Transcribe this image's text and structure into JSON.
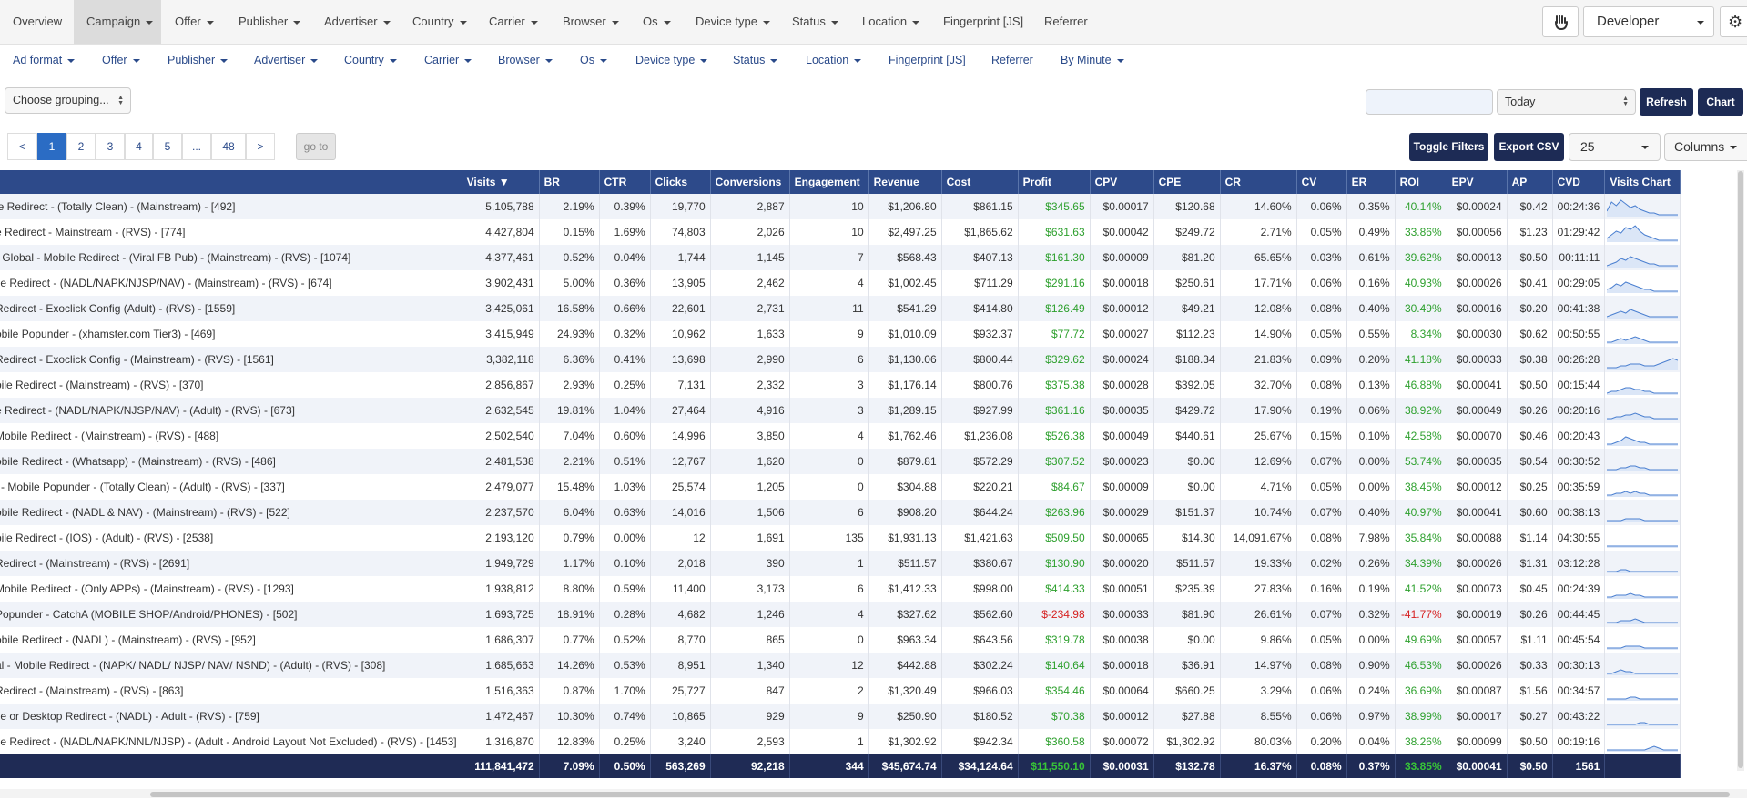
{
  "topnav": {
    "items": [
      {
        "label": "Overview",
        "caret": false,
        "active": false
      },
      {
        "label": "Campaign",
        "caret": true,
        "active": true
      },
      {
        "label": "Offer",
        "caret": true,
        "active": false
      },
      {
        "label": "Publisher",
        "caret": true,
        "active": false
      },
      {
        "label": "Advertiser",
        "caret": true,
        "active": false
      },
      {
        "label": "Country",
        "caret": true,
        "active": false
      },
      {
        "label": "Carrier",
        "caret": true,
        "active": false
      },
      {
        "label": "Browser",
        "caret": true,
        "active": false
      },
      {
        "label": "Os",
        "caret": true,
        "active": false
      },
      {
        "label": "Device type",
        "caret": true,
        "active": false
      },
      {
        "label": "Status",
        "caret": true,
        "active": false
      },
      {
        "label": "Location",
        "caret": true,
        "active": false
      },
      {
        "label": "Fingerprint [JS]",
        "caret": false,
        "active": false
      },
      {
        "label": "Referrer",
        "caret": false,
        "active": false
      }
    ],
    "user": "Developer"
  },
  "subnav": {
    "items": [
      {
        "label": "Ad format"
      },
      {
        "label": "Offer"
      },
      {
        "label": "Publisher"
      },
      {
        "label": "Advertiser"
      },
      {
        "label": "Country"
      },
      {
        "label": "Carrier"
      },
      {
        "label": "Browser"
      },
      {
        "label": "Os"
      },
      {
        "label": "Device type"
      },
      {
        "label": "Status"
      },
      {
        "label": "Location"
      },
      {
        "label": "Fingerprint [JS]",
        "caret": false
      },
      {
        "label": "Referrer",
        "caret": false
      },
      {
        "label": "By Minute"
      }
    ]
  },
  "controls": {
    "grouping": "Choose grouping...",
    "date_range": "Today",
    "date_input": "",
    "refresh": "Refresh",
    "chart": "Chart",
    "toggle_filters": "Toggle Filters",
    "export_csv": "Export CSV",
    "per_page": "25",
    "columns": "Columns"
  },
  "pagination": {
    "prev": "<",
    "pages": [
      "1",
      "2",
      "3",
      "4",
      "5",
      "...",
      "48"
    ],
    "next": ">",
    "current": "1",
    "goto": "go to"
  },
  "table": {
    "columns": [
      "",
      "Visits ▼",
      "BR",
      "CTR",
      "Clicks",
      "Conversions",
      "Engagement",
      "Revenue",
      "Cost",
      "Profit",
      "CPV",
      "CPE",
      "CR",
      "CV",
      "ER",
      "ROI",
      "EPV",
      "AP",
      "CVD",
      "Visits Chart"
    ],
    "rows": [
      [
        "le Redirect - (Totally Clean) - (Mainstream) - [492]",
        "5,105,788",
        "2.19%",
        "0.39%",
        "19,770",
        "2,887",
        "10",
        "$1,206.80",
        "$861.15",
        "$345.65",
        "$0.00017",
        "$120.68",
        "14.60%",
        "0.06%",
        "0.35%",
        "40.14%",
        "$0.00024",
        "$0.42",
        "00:24:36"
      ],
      [
        "e Redirect - Mainstream - (RVS) - [774]",
        "4,427,804",
        "0.15%",
        "1.69%",
        "74,803",
        "2,026",
        "10",
        "$2,497.25",
        "$1,865.62",
        "$631.63",
        "$0.00042",
        "$249.72",
        "2.71%",
        "0.05%",
        "0.49%",
        "33.86%",
        "$0.00056",
        "$1.23",
        "01:29:42"
      ],
      [
        "- Global - Mobile Redirect - (Viral FB Pub) - (Mainstream) - (RVS) - [1074]",
        "4,377,461",
        "0.52%",
        "0.04%",
        "1,744",
        "1,145",
        "7",
        "$568.43",
        "$407.13",
        "$161.30",
        "$0.00009",
        "$81.20",
        "65.65%",
        "0.03%",
        "0.61%",
        "39.62%",
        "$0.00013",
        "$0.50",
        "00:11:11"
      ],
      [
        "ile Redirect - (NADL/NAPK/NJSP/NAV) - (Mainstream) - (RVS) - [674]",
        "3,902,431",
        "5.00%",
        "0.36%",
        "13,905",
        "2,462",
        "4",
        "$1,002.45",
        "$711.29",
        "$291.16",
        "$0.00018",
        "$250.61",
        "17.71%",
        "0.06%",
        "0.16%",
        "40.93%",
        "$0.00026",
        "$0.41",
        "00:29:05"
      ],
      [
        "Redirect - Exoclick Config (Adult) - (RVS) - [1559]",
        "3,425,061",
        "16.58%",
        "0.66%",
        "22,601",
        "2,731",
        "11",
        "$541.29",
        "$414.80",
        "$126.49",
        "$0.00012",
        "$49.21",
        "12.08%",
        "0.08%",
        "0.40%",
        "30.49%",
        "$0.00016",
        "$0.20",
        "00:41:38"
      ],
      [
        "obile Popunder - (xhamster.com Tier3) - [469]",
        "3,415,949",
        "24.93%",
        "0.32%",
        "10,962",
        "1,633",
        "9",
        "$1,010.09",
        "$932.37",
        "$77.72",
        "$0.00027",
        "$112.23",
        "14.90%",
        "0.05%",
        "0.55%",
        "8.34%",
        "$0.00030",
        "$0.62",
        "00:50:55"
      ],
      [
        "Redirect - Exoclick Config - (Mainstream) - (RVS) - [1561]",
        "3,382,118",
        "6.36%",
        "0.41%",
        "13,698",
        "2,990",
        "6",
        "$1,130.06",
        "$800.44",
        "$329.62",
        "$0.00024",
        "$188.34",
        "21.83%",
        "0.09%",
        "0.20%",
        "41.18%",
        "$0.00033",
        "$0.38",
        "00:26:28"
      ],
      [
        "bile Redirect - (Mainstream) - (RVS) - [370]",
        "2,856,867",
        "2.93%",
        "0.25%",
        "7,131",
        "2,332",
        "3",
        "$1,176.14",
        "$800.76",
        "$375.38",
        "$0.00028",
        "$392.05",
        "32.70%",
        "0.08%",
        "0.13%",
        "46.88%",
        "$0.00041",
        "$0.50",
        "00:15:44"
      ],
      [
        "e Redirect - (NADL/NAPK/NJSP/NAV) - (Adult) - (RVS) - [673]",
        "2,632,545",
        "19.81%",
        "1.04%",
        "27,464",
        "4,916",
        "3",
        "$1,289.15",
        "$927.99",
        "$361.16",
        "$0.00035",
        "$429.72",
        "17.90%",
        "0.19%",
        "0.06%",
        "38.92%",
        "$0.00049",
        "$0.26",
        "00:20:16"
      ],
      [
        "Mobile Redirect - (Mainstream) - (RVS) - [488]",
        "2,502,540",
        "7.04%",
        "0.60%",
        "14,996",
        "3,850",
        "4",
        "$1,762.46",
        "$1,236.08",
        "$526.38",
        "$0.00049",
        "$440.61",
        "25.67%",
        "0.15%",
        "0.10%",
        "42.58%",
        "$0.00070",
        "$0.46",
        "00:20:43"
      ],
      [
        "obile Redirect - (Whatsapp) - (Mainstream) - (RVS) - [486]",
        "2,481,538",
        "2.21%",
        "0.51%",
        "12,767",
        "1,620",
        "0",
        "$879.81",
        "$572.29",
        "$307.52",
        "$0.00023",
        "$0.00",
        "12.69%",
        "0.07%",
        "0.00%",
        "53.74%",
        "$0.00035",
        "$0.54",
        "00:30:52"
      ],
      [
        "l - Mobile Popunder - (Totally Clean) - (Adult) - (RVS) - [337]",
        "2,479,077",
        "15.48%",
        "1.03%",
        "25,574",
        "1,205",
        "0",
        "$304.88",
        "$220.21",
        "$84.67",
        "$0.00009",
        "$0.00",
        "4.71%",
        "0.05%",
        "0.00%",
        "38.45%",
        "$0.00012",
        "$0.25",
        "00:35:59"
      ],
      [
        "obile Redirect - (NADL & NAV) - (Mainstream) - (RVS) - [522]",
        "2,237,570",
        "6.04%",
        "0.63%",
        "14,016",
        "1,506",
        "6",
        "$908.20",
        "$644.24",
        "$263.96",
        "$0.00029",
        "$151.37",
        "10.74%",
        "0.07%",
        "0.40%",
        "40.97%",
        "$0.00041",
        "$0.60",
        "00:38:13"
      ],
      [
        "bile Redirect - (IOS) - (Adult) - (RVS) - [2538]",
        "2,193,120",
        "0.79%",
        "0.00%",
        "12",
        "1,691",
        "135",
        "$1,931.13",
        "$1,421.63",
        "$509.50",
        "$0.00065",
        "$14.30",
        "14,091.67%",
        "0.08%",
        "7.98%",
        "35.84%",
        "$0.00088",
        "$1.14",
        "04:30:55"
      ],
      [
        "Redirect - (Mainstream) - (RVS) - [2691]",
        "1,949,729",
        "1.17%",
        "0.10%",
        "2,018",
        "390",
        "1",
        "$511.57",
        "$380.67",
        "$130.90",
        "$0.00020",
        "$511.57",
        "19.33%",
        "0.02%",
        "0.26%",
        "34.39%",
        "$0.00026",
        "$1.31",
        "03:12:28"
      ],
      [
        "Mobile Redirect - (Only APPs) - (Mainstream) - (RVS) - [1293]",
        "1,938,812",
        "8.80%",
        "0.59%",
        "11,400",
        "3,173",
        "6",
        "$1,412.33",
        "$998.00",
        "$414.33",
        "$0.00051",
        "$235.39",
        "27.83%",
        "0.16%",
        "0.19%",
        "41.52%",
        "$0.00073",
        "$0.45",
        "00:24:39"
      ],
      [
        "Popunder - CatchA (MOBILE SHOP/Android/PHONES) - [502]",
        "1,693,725",
        "18.91%",
        "0.28%",
        "4,682",
        "1,246",
        "4",
        "$327.62",
        "$562.60",
        "$-234.98",
        "$0.00033",
        "$81.90",
        "26.61%",
        "0.07%",
        "0.32%",
        "-41.77%",
        "$0.00019",
        "$0.26",
        "00:44:45"
      ],
      [
        "obile Redirect - (NADL) - (Mainstream) - (RVS) - [952]",
        "1,686,307",
        "0.77%",
        "0.52%",
        "8,770",
        "865",
        "0",
        "$963.34",
        "$643.56",
        "$319.78",
        "$0.00038",
        "$0.00",
        "9.86%",
        "0.05%",
        "0.00%",
        "49.69%",
        "$0.00057",
        "$1.11",
        "00:45:54"
      ],
      [
        "al - Mobile Redirect - (NAPK/ NADL/ NJSP/ NAV/ NSND) - (Adult) - (RVS) - [308]",
        "1,685,663",
        "14.26%",
        "0.53%",
        "8,951",
        "1,340",
        "12",
        "$442.88",
        "$302.24",
        "$140.64",
        "$0.00018",
        "$36.91",
        "14.97%",
        "0.08%",
        "0.90%",
        "46.53%",
        "$0.00026",
        "$0.33",
        "00:30:13"
      ],
      [
        "Redirect - (Mainstream) - (RVS) - [863]",
        "1,516,363",
        "0.87%",
        "1.70%",
        "25,727",
        "847",
        "2",
        "$1,320.49",
        "$966.03",
        "$354.46",
        "$0.00064",
        "$660.25",
        "3.29%",
        "0.06%",
        "0.24%",
        "36.69%",
        "$0.00087",
        "$1.56",
        "00:34:57"
      ],
      [
        "ile or Desktop Redirect - (NADL) - Adult - (RVS) - [759]",
        "1,472,467",
        "10.30%",
        "0.74%",
        "10,865",
        "929",
        "9",
        "$250.90",
        "$180.52",
        "$70.38",
        "$0.00012",
        "$27.88",
        "8.55%",
        "0.06%",
        "0.97%",
        "38.99%",
        "$0.00017",
        "$0.27",
        "00:43:22"
      ],
      [
        "ile Redirect - (NADL/NAPK/NNL/NJSP) - (Adult - Android Layout Not Excluded) - (RVS) - [1453]",
        "1,316,870",
        "12.83%",
        "0.25%",
        "3,240",
        "2,593",
        "1",
        "$1,302.92",
        "$942.34",
        "$360.58",
        "$0.00072",
        "$1,302.92",
        "80.03%",
        "0.20%",
        "0.04%",
        "38.26%",
        "$0.00099",
        "$0.50",
        "00:19:16"
      ]
    ],
    "totals": [
      "",
      "111,841,472",
      "7.09%",
      "0.50%",
      "563,269",
      "92,218",
      "344",
      "$45,674.74",
      "$34,124.64",
      "$11,550.10",
      "$0.00031",
      "$132.78",
      "16.37%",
      "0.08%",
      "0.37%",
      "33.85%",
      "$0.00041",
      "$0.50",
      "1561",
      ""
    ],
    "sparkline_color": "#4a7fd0",
    "sparklines": [
      [
        3,
        8,
        6,
        9,
        7,
        5,
        6,
        4,
        3,
        2,
        2,
        1,
        1,
        1,
        1,
        1
      ],
      [
        2,
        4,
        6,
        5,
        8,
        7,
        9,
        6,
        4,
        3,
        2,
        1,
        1,
        1,
        1,
        1
      ],
      [
        1,
        2,
        3,
        5,
        4,
        6,
        5,
        4,
        3,
        2,
        2,
        1,
        1,
        1,
        1,
        1
      ],
      [
        2,
        3,
        5,
        4,
        6,
        5,
        4,
        3,
        2,
        2,
        1,
        1,
        1,
        1,
        1,
        1
      ],
      [
        1,
        2,
        3,
        4,
        3,
        5,
        4,
        3,
        2,
        1,
        1,
        1,
        1,
        1,
        1,
        1
      ],
      [
        1,
        1,
        2,
        3,
        2,
        3,
        4,
        3,
        2,
        1,
        1,
        1,
        1,
        1,
        1,
        1
      ],
      [
        1,
        1,
        1,
        2,
        2,
        3,
        3,
        3,
        2,
        2,
        2,
        3,
        4,
        5,
        6,
        5
      ],
      [
        1,
        2,
        2,
        3,
        4,
        4,
        3,
        3,
        2,
        2,
        1,
        1,
        1,
        1,
        1,
        1
      ],
      [
        1,
        1,
        2,
        2,
        3,
        3,
        4,
        3,
        2,
        2,
        1,
        1,
        1,
        1,
        1,
        1
      ],
      [
        1,
        1,
        2,
        3,
        5,
        4,
        3,
        2,
        2,
        1,
        1,
        1,
        1,
        1,
        1,
        1
      ],
      [
        1,
        1,
        1,
        2,
        2,
        3,
        3,
        2,
        2,
        1,
        1,
        1,
        1,
        1,
        1,
        1
      ],
      [
        1,
        1,
        2,
        2,
        3,
        2,
        3,
        2,
        2,
        1,
        1,
        1,
        1,
        1,
        1,
        1
      ],
      [
        1,
        1,
        1,
        1,
        2,
        2,
        2,
        2,
        1,
        1,
        1,
        1,
        1,
        1,
        1,
        1
      ],
      [
        1,
        1,
        1,
        1,
        1,
        1,
        1,
        1,
        1,
        1,
        1,
        1,
        1,
        1,
        1,
        1
      ],
      [
        1,
        1,
        1,
        2,
        2,
        1,
        1,
        1,
        1,
        1,
        1,
        1,
        1,
        1,
        1,
        1
      ],
      [
        1,
        1,
        2,
        2,
        2,
        3,
        2,
        2,
        1,
        1,
        1,
        1,
        1,
        1,
        1,
        1
      ],
      [
        1,
        1,
        1,
        2,
        2,
        2,
        3,
        2,
        1,
        1,
        1,
        1,
        1,
        1,
        1,
        1
      ],
      [
        1,
        1,
        1,
        1,
        2,
        2,
        2,
        2,
        1,
        1,
        1,
        1,
        1,
        1,
        1,
        1
      ],
      [
        1,
        1,
        2,
        3,
        2,
        2,
        1,
        1,
        1,
        1,
        1,
        1,
        1,
        1,
        1,
        1
      ],
      [
        1,
        1,
        1,
        1,
        1,
        2,
        2,
        1,
        1,
        1,
        1,
        1,
        1,
        1,
        1,
        1
      ],
      [
        1,
        1,
        1,
        1,
        1,
        1,
        1,
        2,
        2,
        1,
        1,
        1,
        1,
        1,
        1,
        1
      ],
      [
        1,
        1,
        1,
        1,
        1,
        1,
        1,
        1,
        1,
        2,
        3,
        2,
        1,
        1,
        1,
        1
      ]
    ]
  }
}
